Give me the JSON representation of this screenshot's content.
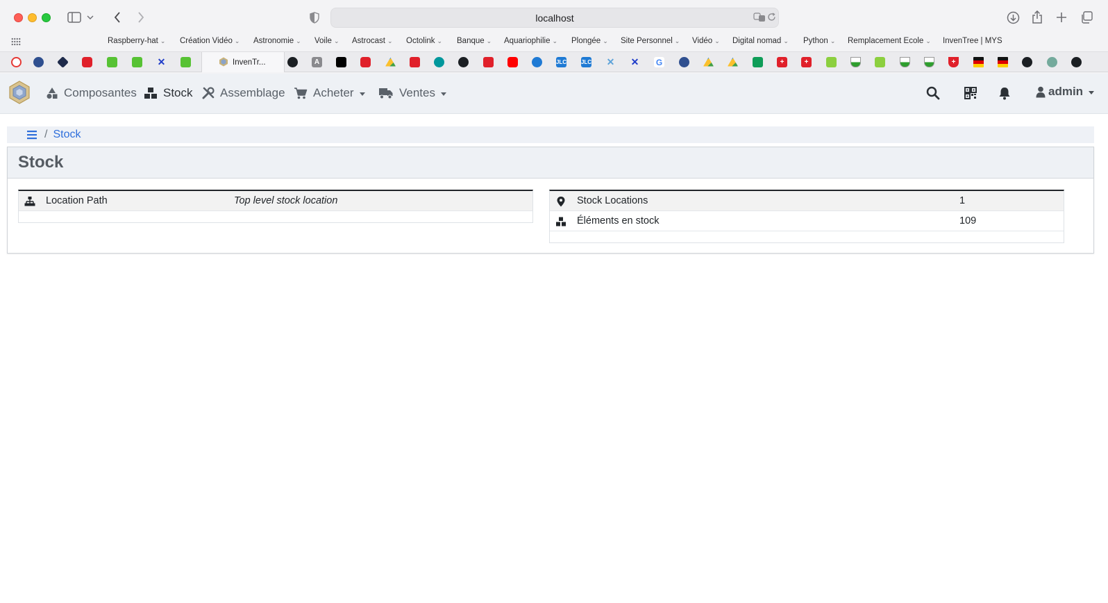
{
  "browser": {
    "url": "localhost",
    "bookmarks": [
      {
        "label": "Raspberry-hat",
        "dropdown": true
      },
      {
        "label": "Création Vidéo",
        "dropdown": true
      },
      {
        "label": "Astronomie",
        "dropdown": true
      },
      {
        "label": "Voile",
        "dropdown": true
      },
      {
        "label": "Astrocast",
        "dropdown": true
      },
      {
        "label": "Octolink",
        "dropdown": true
      },
      {
        "label": "Banque",
        "dropdown": true
      },
      {
        "label": "Aquariophilie",
        "dropdown": true
      },
      {
        "label": "Plongée",
        "dropdown": true
      },
      {
        "label": "Site Personnel",
        "dropdown": true
      },
      {
        "label": "Vidéo",
        "dropdown": true
      },
      {
        "label": "Digital nomad",
        "dropdown": true
      },
      {
        "label": "Python",
        "dropdown": true
      },
      {
        "label": "Remplacement Ecole",
        "dropdown": true
      },
      {
        "label": "InvenTree | MYS",
        "dropdown": false
      }
    ],
    "active_tab_label": "InvenTr...",
    "tab_text_icons": [
      "A",
      "JLC",
      "JLC",
      "G"
    ]
  },
  "navbar": {
    "items": [
      {
        "label": "Composantes",
        "icon": "shapes-icon"
      },
      {
        "label": "Stock",
        "icon": "boxes-icon"
      },
      {
        "label": "Assemblage",
        "icon": "tools-icon"
      },
      {
        "label": "Acheter",
        "icon": "cart-icon"
      },
      {
        "label": "Ventes",
        "icon": "truck-icon"
      }
    ],
    "user": "admin"
  },
  "breadcrumb": {
    "current": "Stock"
  },
  "panel": {
    "title": "Stock",
    "left_table": {
      "rows": [
        {
          "label": "Location Path",
          "value": "Top level stock location",
          "icon": "sitemap-icon"
        }
      ]
    },
    "right_table": {
      "rows": [
        {
          "label": "Stock Locations",
          "value": "1",
          "icon": "map-marker-icon"
        },
        {
          "label": "Éléments en stock",
          "value": "109",
          "icon": "boxes-icon"
        }
      ]
    }
  },
  "colors": {
    "link": "#2f6fdb",
    "navbar_bg": "#eef1f5"
  }
}
